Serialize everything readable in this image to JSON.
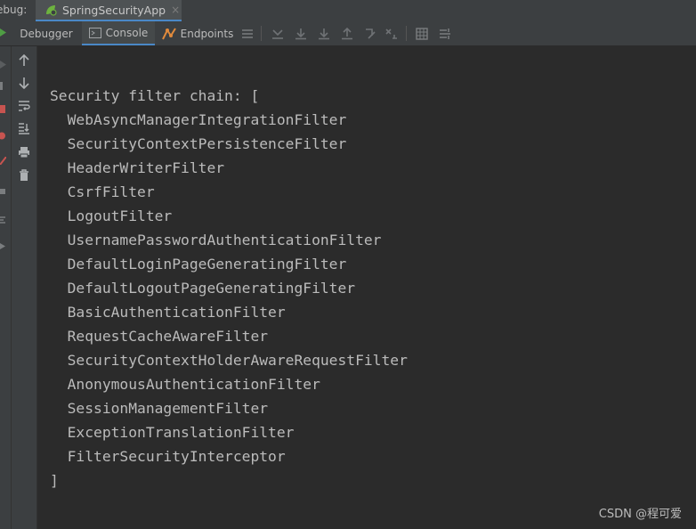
{
  "header": {
    "debug_label": "ebug:",
    "session_tab": {
      "title": "SpringSecurityApp",
      "close": "×"
    }
  },
  "toolbar": {
    "tabs": [
      {
        "label": "Debugger",
        "icon": "none"
      },
      {
        "label": "Console",
        "icon": "console-icon",
        "active": true
      },
      {
        "label": "Endpoints",
        "icon": "endpoints-icon"
      }
    ],
    "icons": [
      "menu-icon",
      "show-execution-point-icon",
      "step-over-icon",
      "step-into-icon",
      "force-step-into-icon",
      "step-out-icon",
      "drop-frame-icon",
      "run-to-cursor-icon",
      "evaluate-expression-icon",
      "trace-icon"
    ]
  },
  "console": {
    "lines": [
      "Security filter chain: [",
      "  WebAsyncManagerIntegrationFilter",
      "  SecurityContextPersistenceFilter",
      "  HeaderWriterFilter",
      "  CsrfFilter",
      "  LogoutFilter",
      "  UsernamePasswordAuthenticationFilter",
      "  DefaultLoginPageGeneratingFilter",
      "  DefaultLogoutPageGeneratingFilter",
      "  BasicAuthenticationFilter",
      "  RequestCacheAwareFilter",
      "  SecurityContextHolderAwareRequestFilter",
      "  AnonymousAuthenticationFilter",
      "  SessionManagementFilter",
      "  ExceptionTranslationFilter",
      "  FilterSecurityInterceptor",
      "]"
    ]
  },
  "watermark": "CSDN @程可爱",
  "colors": {
    "background": "#2b2b2b",
    "toolbar": "#3c3f41",
    "text": "#bbbbbb",
    "accent": "#4a88c7",
    "spring_green": "#6db33f",
    "endpoints_orange": "#e08a3c"
  }
}
